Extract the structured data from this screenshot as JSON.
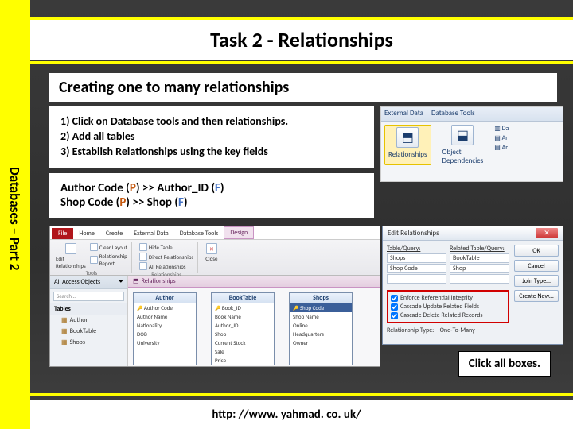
{
  "sidebar_label": "Databases – Part 2",
  "title": "Task 2 - Relationships",
  "subtitle": "Creating one to many relationships",
  "instructions": {
    "i1": "1)   Click on Database tools and then relationships.",
    "i2": "2)   Add all tables",
    "i3": "3)   Establish Relationships using the key fields"
  },
  "mapping": {
    "a1": "Author Code (",
    "p": "P",
    "a2": ") >> Author_ID (",
    "f": "F",
    "a3": ")",
    "b1": "Shop Code (",
    "b2": ") >> Shop (",
    "b3": ")"
  },
  "ribbon_snip": {
    "tabs": {
      "t1": "External Data",
      "t2": "Database Tools"
    },
    "btn1": "Relationships",
    "btn2": "Object\nDependencies",
    "side": [
      "Da",
      "Ar",
      "Ar"
    ]
  },
  "access": {
    "file": "File",
    "tabs": [
      "Home",
      "Create",
      "External Data",
      "Database Tools",
      "Design"
    ],
    "groups": {
      "g1_items": [
        "Edit\nRelationships",
        "Clear Layout",
        "Relationship\nReport"
      ],
      "g1_label": "Tools",
      "g2_items": [
        "Hide Table",
        "Direct Relationships",
        "All Relationships"
      ],
      "g2_label": "Relationships",
      "g3_item": "Close",
      "g3_label": ""
    },
    "nav_title": "All Access Objects",
    "search": "Search…",
    "nav_group": "Tables",
    "objects": [
      "Author",
      "BookTable",
      "Shops"
    ],
    "canvas_tab": "Relationships",
    "tables": {
      "author": {
        "title": "Author",
        "fields": [
          "Author Code",
          "Author Name",
          "Nationality",
          "DOB",
          "University"
        ]
      },
      "book": {
        "title": "BookTable",
        "fields": [
          "Book_ID",
          "Book Name",
          "Author_ID",
          "Shop",
          "Current Stock",
          "Sale",
          "Price"
        ]
      },
      "shops": {
        "title": "Shops",
        "fields": [
          "Shop Code",
          "Shop Name",
          "Online",
          "Headquarters",
          "Owner"
        ]
      }
    }
  },
  "edit_rel": {
    "title": "Edit Relationships",
    "h1": "Table/Query:",
    "h2": "Related Table/Query:",
    "r1a": "Shops",
    "r1b": "BookTable",
    "r2a": "Shop Code",
    "r2b": "Shop",
    "btn_ok": "OK",
    "btn_cancel": "Cancel",
    "btn_join": "Join Type…",
    "btn_new": "Create New…",
    "chk1": "Enforce Referential Integrity",
    "chk2": "Cascade Update Related Fields",
    "chk3": "Cascade Delete Related Records",
    "type_l": "Relationship Type:",
    "type_v": "One-To-Many"
  },
  "callout": "Click all boxes.",
  "footer": "http: //www. yahmad. co. uk/"
}
